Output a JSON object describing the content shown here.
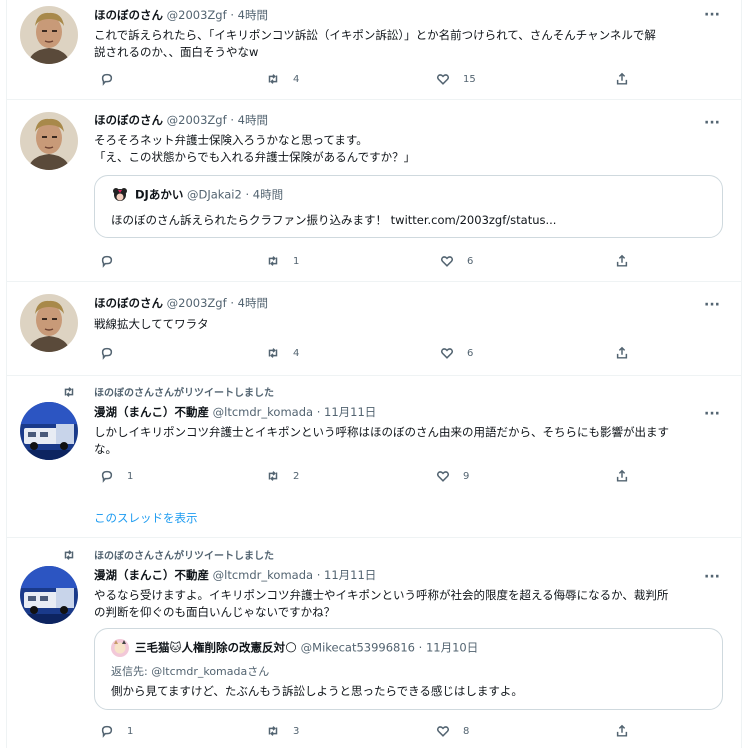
{
  "tweets": [
    {
      "name": "ほのぼのさん",
      "handle": "@2003Zgf",
      "time": "4時間",
      "text_line1": "これで訴えられたら、「イキリポンコツ訴訟（イキポン訴訟）」とか名前つけられて、さんそんチャンネルで解",
      "text_line2": "説されるのか、、面白そうやなw",
      "reply_count": "",
      "retweet_count": "4",
      "like_count": "15"
    },
    {
      "name": "ほのぼのさん",
      "handle": "@2003Zgf",
      "time": "4時間",
      "text_line1": "そろそろネット弁護士保険入ろうかなと思ってます。",
      "text_line2": "「え、この状態からでも入れる弁護士保険があるんですか？」",
      "quote": {
        "name": "DJあかい",
        "handle": "@DJakai2",
        "time": "4時間",
        "text": "ほのぼのさん訴えられたらクラファン振り込みます！ twitter.com/2003zgf/status..."
      },
      "reply_count": "",
      "retweet_count": "1",
      "like_count": "6"
    },
    {
      "name": "ほのぼのさん",
      "handle": "@2003Zgf",
      "time": "4時間",
      "text_line1": "戦線拡大しててワラタ",
      "reply_count": "",
      "retweet_count": "4",
      "like_count": "6"
    },
    {
      "retweet_context": "ほのぼのさんさんがリツイートしました",
      "name": "漫湖（まんこ）不動産",
      "handle": "@ltcmdr_komada",
      "time": "11月11日",
      "text_line1": "しかしイキリポンコツ弁護士とイキポンという呼称はほのぼのさん由来の用語だから、そちらにも影響が出ます",
      "text_line2": "な。",
      "reply_count": "1",
      "retweet_count": "2",
      "like_count": "9",
      "thread_link": "このスレッドを表示"
    },
    {
      "retweet_context": "ほのぼのさんさんがリツイートしました",
      "name": "漫湖（まんこ）不動産",
      "handle": "@ltcmdr_komada",
      "time": "11月11日",
      "text_line1": "やるなら受けますよ。イキリポンコツ弁護士やイキポンという呼称が社会的限度を超える侮辱になるか、裁判所",
      "text_line2": "の判断を仰ぐのも面白いんじゃないですかね？",
      "quote": {
        "name": "三毛猫🐱人権削除の改憲反対🌕",
        "handle": "@Mikecat53996816",
        "time": "11月10日",
        "reply_to": "返信先: @ltcmdr_komadaさん",
        "text": "側から見てますけど、たぶんもう訴訟しようと思ったらできる感じはしますよ。"
      },
      "reply_count": "1",
      "retweet_count": "3",
      "like_count": "8"
    }
  ],
  "separator": "·",
  "colors": {
    "text": "#0f1419",
    "muted": "#536471",
    "link": "#1d9bf0",
    "border": "#cfd9de"
  }
}
